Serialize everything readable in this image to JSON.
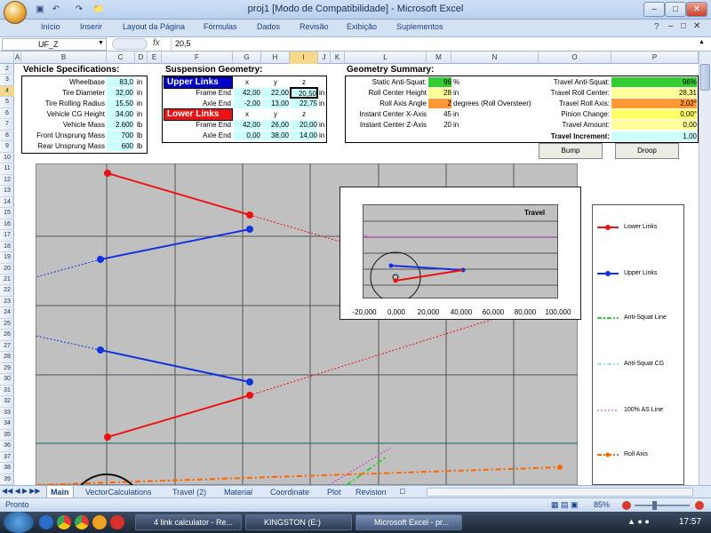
{
  "window": {
    "title": "proj1  [Modo de Compatibilidade] - Microsoft Excel"
  },
  "ribbon_tabs": [
    "Início",
    "Inserir",
    "Layout da Página",
    "Fórmulas",
    "Dados",
    "Revisão",
    "Exibição",
    "Suplementos"
  ],
  "formula_bar": {
    "name_box": "UF_Z",
    "fx": "fx",
    "value": "20,5"
  },
  "columns": [
    "A",
    "B",
    "C",
    "D",
    "E",
    "F",
    "G",
    "H",
    "I",
    "J",
    "K",
    "L",
    "M",
    "N",
    "O",
    "P"
  ],
  "rows": [
    "2",
    "3",
    "4",
    "5",
    "6",
    "7",
    "8",
    "9",
    "10",
    "11",
    "12",
    "13",
    "14",
    "15",
    "16",
    "17",
    "18",
    "19",
    "20",
    "21",
    "22",
    "23",
    "24",
    "25",
    "26",
    "27",
    "28",
    "29",
    "30",
    "31",
    "32",
    "33",
    "34",
    "35",
    "36",
    "37",
    "38",
    "39"
  ],
  "vehicle": {
    "title": "Vehicle Specifications:",
    "rows": [
      {
        "label": "Wheelbase",
        "value": "83,0",
        "unit": "in"
      },
      {
        "label": "Tire Diameter",
        "value": "32,00",
        "unit": "in"
      },
      {
        "label": "Tire Rolling Radius",
        "value": "15,50",
        "unit": "in"
      },
      {
        "label": "Vehicle CG Height",
        "value": "34,00",
        "unit": "in"
      },
      {
        "label": "Vehicle Mass",
        "value": "2.600",
        "unit": "lb"
      },
      {
        "label": "Front Unsprung Mass",
        "value": "700",
        "unit": "lb"
      },
      {
        "label": "Rear Unsprung Mass",
        "value": "600",
        "unit": "lb"
      }
    ]
  },
  "suspension": {
    "title": "Suspension Geometry:",
    "upper_title": "Upper Links",
    "lower_title": "Lower Links",
    "axes": [
      "x",
      "y",
      "z"
    ],
    "upper": [
      {
        "label": "Frame End",
        "x": "42,00",
        "y": "22,00",
        "z": "20,50",
        "unit": "in"
      },
      {
        "label": "Axle End",
        "x": "-2,00",
        "y": "13,00",
        "z": "22,75",
        "unit": "in"
      }
    ],
    "lower": [
      {
        "label": "Frame End",
        "x": "42,00",
        "y": "26,00",
        "z": "20,00",
        "unit": "in"
      },
      {
        "label": "Axle End",
        "x": "0,00",
        "y": "38,00",
        "z": "14,00",
        "unit": "in"
      }
    ]
  },
  "summary": {
    "title": "Geometry Summary:",
    "left": [
      {
        "label": "Static Anti-Squat:",
        "value": "96",
        "unit": "%",
        "color": "#33cc33"
      },
      {
        "label": "Roll Center Height",
        "value": "28",
        "unit": "in",
        "color": "#ffff99"
      },
      {
        "label": "Roll Axis Angle",
        "value": "2",
        "unit": "degrees (Roll Oversteer)",
        "color": "#ff9933"
      },
      {
        "label": "Instant Center X-Axis",
        "value": "45",
        "unit": "in",
        "color": ""
      },
      {
        "label": "Instant Center Z-Axis",
        "value": "20",
        "unit": "in",
        "color": ""
      }
    ],
    "right": [
      {
        "label": "Travel Anti-Squat:",
        "value": "96%",
        "color": "#33cc33"
      },
      {
        "label": "Travel Roll Center:",
        "value": "28,31",
        "color": "#ffff99"
      },
      {
        "label": "Travel Roll Axis:",
        "value": "2,02°",
        "color": "#ff9933"
      },
      {
        "label": "Pinion Change:",
        "value": "0,00°",
        "color": "#ffff66"
      },
      {
        "label": "Travel Amount:",
        "value": "0,00",
        "color": "#ffff99"
      },
      {
        "label": "Travel Increment:",
        "value": "1,00",
        "color": "#ccffff"
      }
    ],
    "bump": "Bump",
    "droop": "Droop"
  },
  "inset_chart": {
    "title": "Travel",
    "x_ticks": [
      "-20,000",
      "0,000",
      "20,000",
      "40,000",
      "60,000",
      "80,000",
      "100,000"
    ],
    "colors": {
      "lower": "#ff1111",
      "upper": "#1133dd"
    }
  },
  "legend": [
    {
      "name": "Lower Links",
      "color": "#ff1111",
      "style": "solid-marker"
    },
    {
      "name": "Upper Links",
      "color": "#1133dd",
      "style": "solid-marker"
    },
    {
      "name": "Anti-Squat Line",
      "color": "#33cc33",
      "style": "dashdot"
    },
    {
      "name": "Anti-Squat CG",
      "color": "#33cccc",
      "style": "dashdot"
    },
    {
      "name": "100% AS Line",
      "color": "#cc33cc",
      "style": "dotted"
    },
    {
      "name": "Roll Axis",
      "color": "#ff6600",
      "style": "dashdot-marker"
    }
  ],
  "sheet_tabs": [
    "Main",
    "VectorCalculations",
    "Travel (2)",
    "Material",
    "Coordinate",
    "Plot",
    "Revision"
  ],
  "status": {
    "text": "Pronto",
    "zoom": "85%"
  },
  "taskbar": {
    "items": [
      "4 link calculator - Re...",
      "KINGSTON (E:)",
      "Microsoft Excel - pr..."
    ],
    "clock": "17:57"
  }
}
